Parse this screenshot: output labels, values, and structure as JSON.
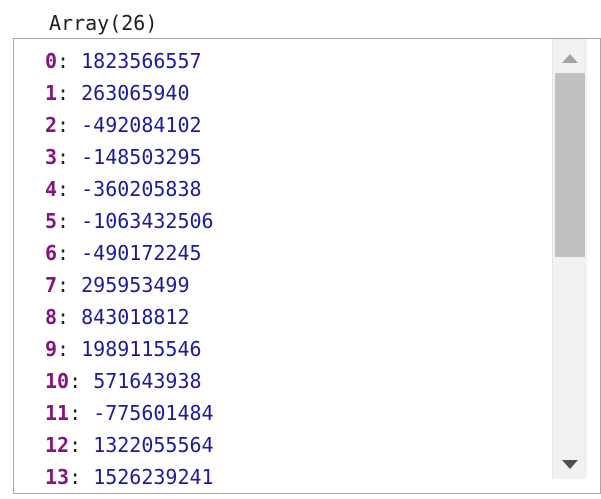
{
  "header": {
    "label": "Array(26)"
  },
  "array": {
    "items": [
      {
        "index": "0",
        "value": "1823566557"
      },
      {
        "index": "1",
        "value": "263065940"
      },
      {
        "index": "2",
        "value": "-492084102"
      },
      {
        "index": "3",
        "value": "-148503295"
      },
      {
        "index": "4",
        "value": "-360205838"
      },
      {
        "index": "5",
        "value": "-1063432506"
      },
      {
        "index": "6",
        "value": "-490172245"
      },
      {
        "index": "7",
        "value": "295953499"
      },
      {
        "index": "8",
        "value": "843018812"
      },
      {
        "index": "9",
        "value": "1989115546"
      },
      {
        "index": "10",
        "value": "571643938"
      },
      {
        "index": "11",
        "value": "-775601484"
      },
      {
        "index": "12",
        "value": "1322055564"
      },
      {
        "index": "13",
        "value": "1526239241"
      }
    ],
    "separator": ": "
  },
  "scrollbar": {
    "up_icon": "triangle-up-icon",
    "down_icon": "triangle-down-icon"
  },
  "colors": {
    "index": "#881280",
    "value": "#1a1aa6",
    "thumb": "#c1c1c1",
    "track": "#f1f1f1"
  }
}
